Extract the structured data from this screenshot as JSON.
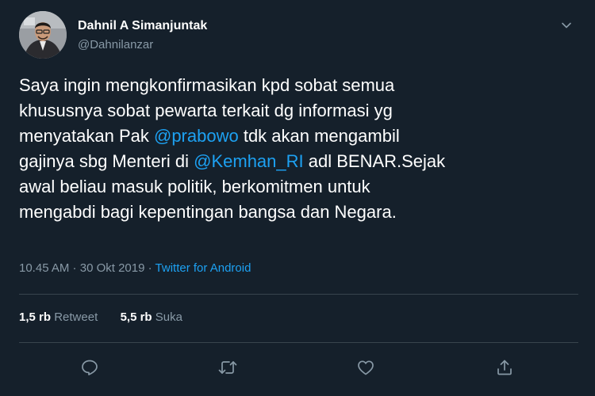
{
  "user": {
    "display_name": "Dahnil A Simanjuntak",
    "handle": "@Dahnilanzar"
  },
  "tweet": {
    "lines": [
      [
        {
          "text": "Saya ingin mengkonfirmasikan kpd sobat semua"
        }
      ],
      [
        {
          "text": "khususnya sobat pewarta terkait dg informasi yg"
        }
      ],
      [
        {
          "text": "menyatakan Pak "
        },
        {
          "text": "@prabowo",
          "mention": true
        },
        {
          "text": " tdk akan mengambil"
        }
      ],
      [
        {
          "text": "gajinya sbg Menteri di "
        },
        {
          "text": "@Kemhan_RI",
          "mention": true
        },
        {
          "text": " adl BENAR.Sejak"
        }
      ],
      [
        {
          "text": "awal beliau masuk politik, berkomitmen untuk"
        }
      ],
      [
        {
          "text": "mengabdi bagi kepentingan bangsa dan Negara."
        }
      ]
    ],
    "time": "10.45 AM",
    "separator": " · ",
    "date": "30 Okt 2019",
    "source": "Twitter for Android"
  },
  "stats": {
    "retweets_count": "1,5 rb",
    "retweets_label": "Retweet",
    "likes_count": "5,5 rb",
    "likes_label": "Suka"
  },
  "icons": {
    "more": "chevron-down-icon",
    "reply": "reply-icon",
    "retweet": "retweet-icon",
    "like": "heart-icon",
    "share": "share-icon"
  },
  "colors": {
    "background": "#15202b",
    "text": "#ffffff",
    "secondary": "#8899a6",
    "accent": "#1da1f2",
    "divider": "#38444d"
  }
}
